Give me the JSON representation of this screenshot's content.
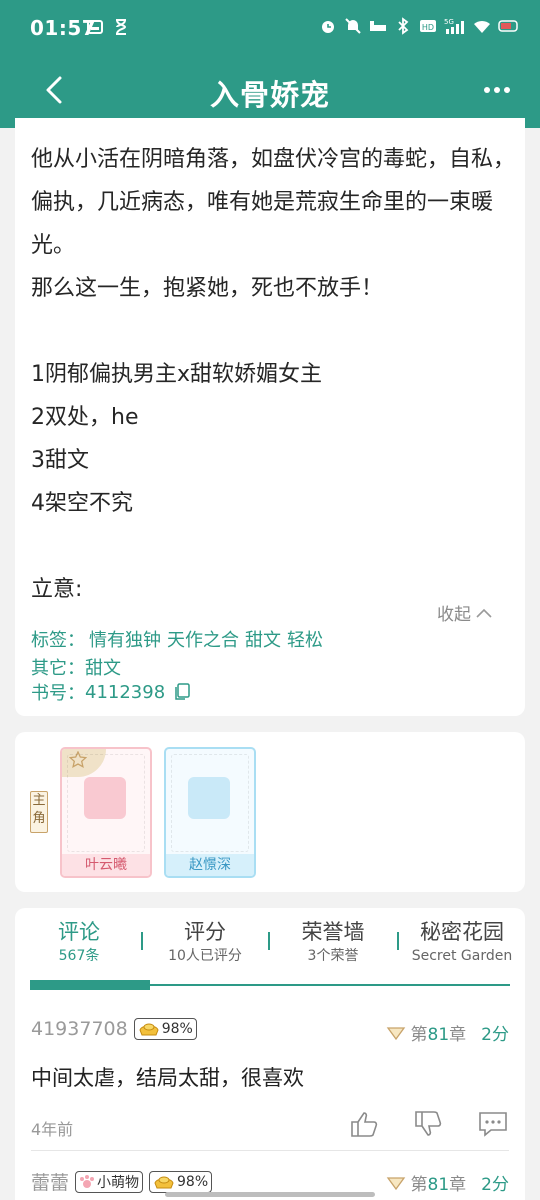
{
  "status": {
    "time": "01:57",
    "signal": "5G"
  },
  "header": {
    "title": "入骨娇宠"
  },
  "synopsis": {
    "lines": [
      "他从小活在阴暗角落，如盘伏冷宫的毒蛇，自私，",
      "偏执，几近病态，唯有她是荒寂生命里的一束暖",
      "光。",
      "那么这一生，抱紧她，死也不放手！",
      "",
      "1阴郁偏执男主x甜软娇媚女主",
      "2双处，he",
      "3甜文",
      "4架空不究",
      "",
      "立意:"
    ],
    "collapse_label": "收起",
    "tags_label": "标签：",
    "tags": [
      "情有独钟",
      "天作之合",
      "甜文",
      "轻松"
    ],
    "other_label": "其它：",
    "other_value": "甜文",
    "book_id_label": "书号：",
    "book_id": "4112398"
  },
  "roles": {
    "side_label": "主角",
    "characters": [
      {
        "name": "叶云曦"
      },
      {
        "name": "赵憬深"
      }
    ]
  },
  "tabs": [
    {
      "label": "评论",
      "sub": "567条"
    },
    {
      "label": "评分",
      "sub": "10人已评分"
    },
    {
      "label": "荣誉墙",
      "sub": "3个荣誉"
    },
    {
      "label": "秘密花园",
      "sub": "Secret Garden"
    }
  ],
  "comments": [
    {
      "user": "41937708",
      "badge_percent": "98%",
      "chapter_prefix": "第",
      "chapter_num": "81",
      "chapter_suffix": "章",
      "score": "2分",
      "text": "中间太虐，结局太甜，很喜欢",
      "date": "4年前"
    },
    {
      "user": "蕾蕾",
      "title_badge": "小萌物",
      "badge_percent": "98%",
      "chapter_prefix": "第",
      "chapter_num": "81",
      "chapter_suffix": "章",
      "score": "2分"
    }
  ],
  "colors": {
    "brand": "#2d9a87",
    "background": "#f2f2f2"
  }
}
